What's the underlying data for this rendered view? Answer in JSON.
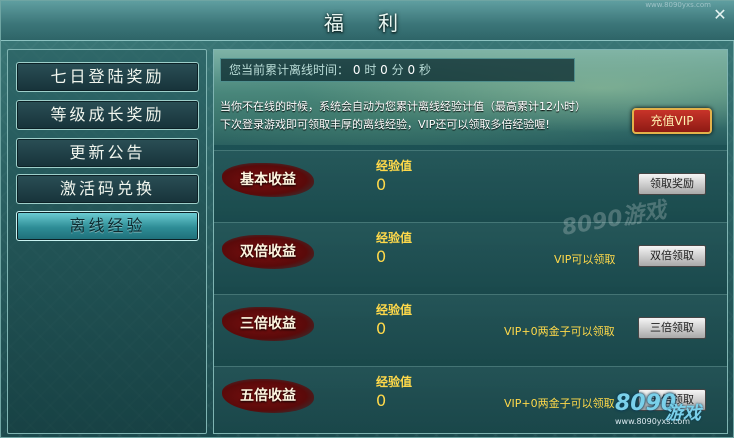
{
  "window": {
    "title": "福 利",
    "top_link": "www.8090yxs.com"
  },
  "sidebar": {
    "items": [
      {
        "label": "七日登陆奖励",
        "active": false
      },
      {
        "label": "等级成长奖励",
        "active": false
      },
      {
        "label": "更新公告",
        "active": false
      },
      {
        "label": "激活码兑换",
        "active": false
      },
      {
        "label": "离线经验",
        "active": true
      }
    ]
  },
  "offline": {
    "timer_prefix": "您当前累计离线时间：",
    "hours": "0",
    "hours_unit": "时",
    "minutes": "0",
    "minutes_unit": "分",
    "seconds": "0",
    "seconds_unit": "秒",
    "desc_line1": "当你不在线的时候，系统会自动为您累计离线经验计值（最高累计12小时）",
    "desc_line2": "下次登录游戏即可领取丰厚的离线经验，VIP还可以领取多倍经验喔!",
    "vip_button": "充值VIP",
    "rows": [
      {
        "label": "基本收益",
        "exp_label": "经验值",
        "exp_value": "0",
        "condition": "",
        "button": "领取奖励"
      },
      {
        "label": "双倍收益",
        "exp_label": "经验值",
        "exp_value": "0",
        "condition": "VIP可以领取",
        "button": "双倍领取"
      },
      {
        "label": "三倍收益",
        "exp_label": "经验值",
        "exp_value": "0",
        "condition": "VIP+0两金子可以领取",
        "button": "三倍领取"
      },
      {
        "label": "五倍收益",
        "exp_label": "经验值",
        "exp_value": "0",
        "condition": "VIP+0两金子可以领取",
        "button": "五倍领取"
      }
    ]
  },
  "watermark": {
    "text": "8090游戏",
    "logo_num": "8090",
    "logo_text": "游戏",
    "logo_url": "www.8090yxs.com"
  },
  "colors": {
    "accent_gold": "#ffd94a",
    "label_red": "#7a0f0f",
    "active_tab": "#2e8d96",
    "vip_red": "#c8342a"
  }
}
